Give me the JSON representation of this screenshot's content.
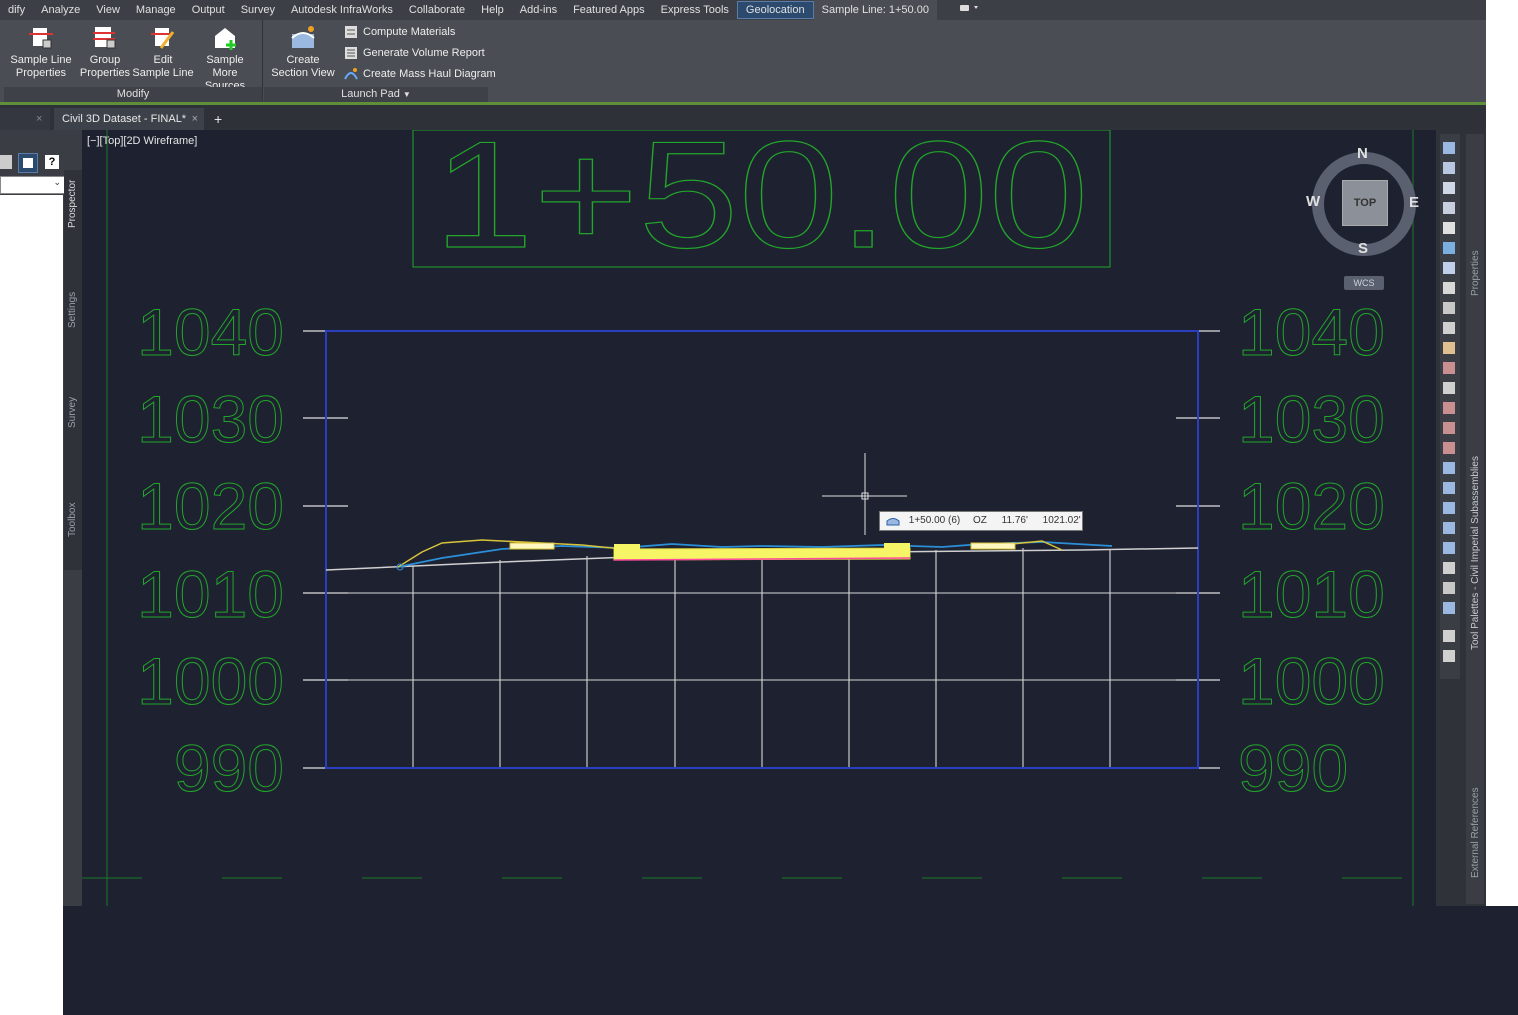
{
  "menu": {
    "items": [
      "dify",
      "Analyze",
      "View",
      "Manage",
      "Output",
      "Survey",
      "Autodesk InfraWorks",
      "Collaborate",
      "Help",
      "Add-ins",
      "Featured Apps",
      "Express Tools",
      "Geolocation",
      "Sample Line: 1+50.00"
    ]
  },
  "ribbon": {
    "modify": {
      "title": "Modify",
      "buttons": [
        {
          "label1": "Sample Line",
          "label2": "Properties"
        },
        {
          "label1": "Group",
          "label2": "Properties"
        },
        {
          "label1": "Edit",
          "label2": "Sample Line"
        },
        {
          "label1": "Sample",
          "label2": "More Sources"
        }
      ]
    },
    "launchpad": {
      "title": "Launch Pad",
      "create_label1": "Create",
      "create_label2": "Section View",
      "small_buttons": [
        "Compute Materials",
        "Generate Volume Report",
        "Create Mass Haul Diagram"
      ]
    }
  },
  "tabs": {
    "doc_title": "Civil 3D Dataset - FINAL*",
    "add_symbol": "+",
    "close_symbol": "×"
  },
  "viewport": {
    "label": "[−][Top][2D Wireframe]"
  },
  "left_panel": {
    "tabs": [
      "Prospector",
      "Settings",
      "Survey",
      "Toolbox"
    ],
    "help_symbol": "?"
  },
  "right_panel": {
    "tabs": [
      "Properties",
      "Tool Palettes - Civil Imperial Subassemblies",
      "External References"
    ]
  },
  "viewcube": {
    "north": "N",
    "south": "S",
    "east": "E",
    "west": "W",
    "top": "TOP",
    "wcs": "WCS"
  },
  "drawing": {
    "station_title": "1+50.00",
    "elevations": [
      "1040",
      "1030",
      "1020",
      "1010",
      "1000",
      "990"
    ]
  },
  "tooltip": {
    "station": "1+50.00 (6)",
    "offset_label": "OZ",
    "offset": "11.76'",
    "elevation": "1021.02'"
  },
  "colors": {
    "accent_green": "#5f8f3a",
    "cad_green": "#22a52a",
    "grid_blue": "#2a3fc0",
    "pavement_yellow": "#f5f566"
  }
}
